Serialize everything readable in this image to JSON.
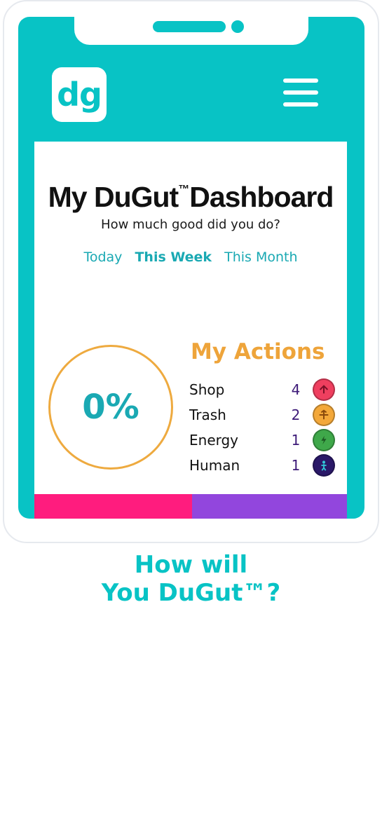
{
  "header": {
    "logo_text": "dg",
    "menu_icon": "hamburger-menu-icon"
  },
  "dashboard": {
    "title_main": "My DuGut",
    "title_tm": "™",
    "title_end": "Dashboard",
    "subtitle": "How much good did you do?",
    "tabs": [
      {
        "label": "Today",
        "active": false
      },
      {
        "label": "This Week",
        "active": true
      },
      {
        "label": "This Month",
        "active": false
      }
    ],
    "progress": {
      "value": "0%",
      "percent": 0,
      "ring_color": "#eeaa3f"
    },
    "actions_title": "My Actions",
    "actions": [
      {
        "label": "Shop",
        "count": "4",
        "icon": "shop-icon",
        "color": "#ef3f5f"
      },
      {
        "label": "Trash",
        "count": "2",
        "icon": "trash-icon",
        "color": "#f3a83a"
      },
      {
        "label": "Energy",
        "count": "1",
        "icon": "energy-icon",
        "color": "#3fa84a"
      },
      {
        "label": "Human",
        "count": "1",
        "icon": "human-icon",
        "color": "#2a1868"
      }
    ]
  },
  "tagline": {
    "line1": "How will",
    "line2": "You DuGut™?"
  },
  "colors": {
    "brand": "#08c3c5",
    "accent_text": "#1aa9b3",
    "actions_title": "#eea43a",
    "bar_left": "#ff1c7e",
    "bar_right": "#9246dd"
  }
}
